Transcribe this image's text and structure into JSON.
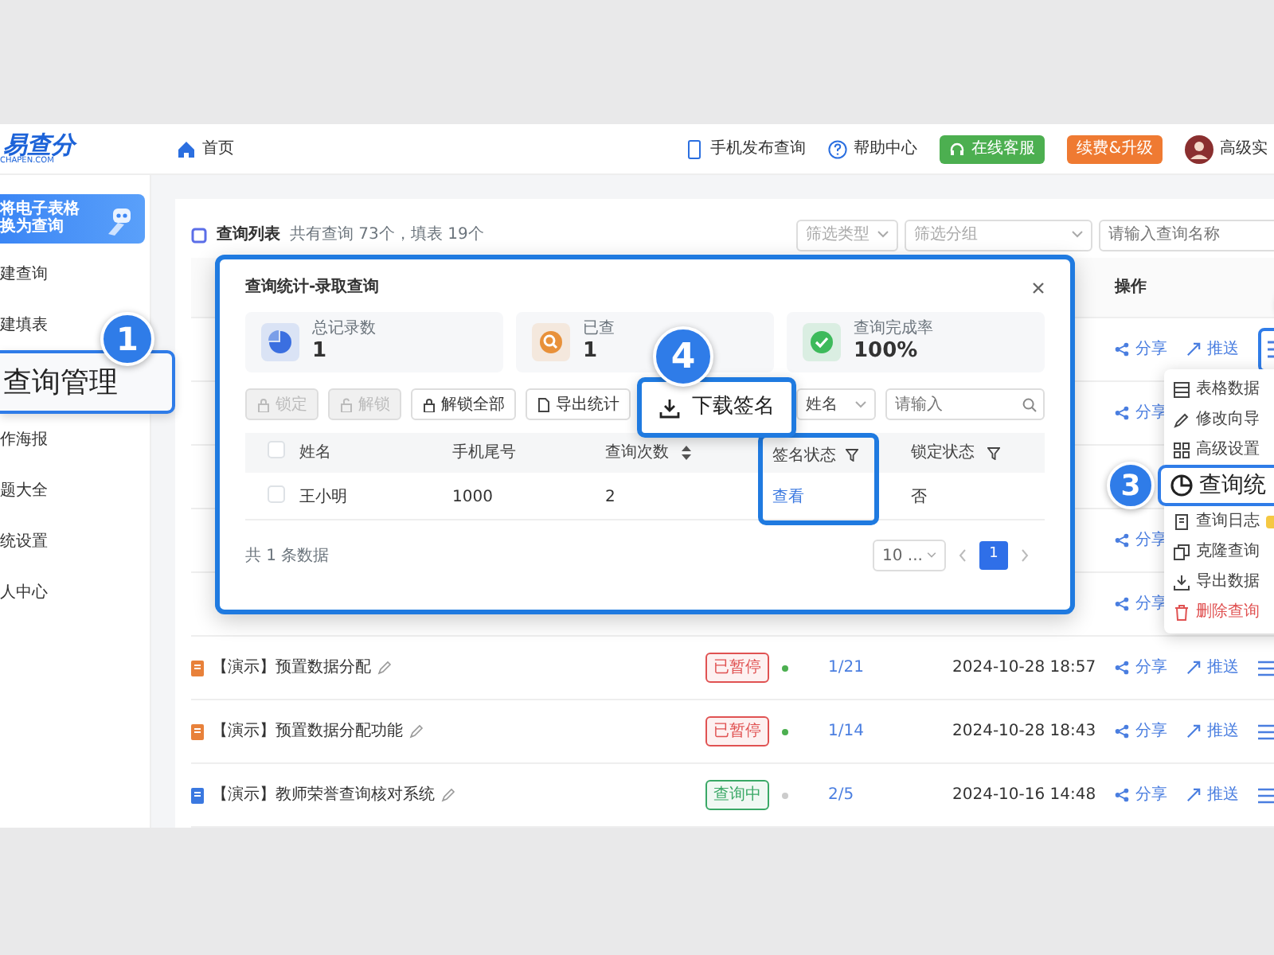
{
  "header": {
    "logo": "易查分",
    "logo_sub": "CHAPEN.COM",
    "home": "首页",
    "links": [
      "手机发布查询",
      "帮助中心"
    ],
    "service_button": "在线客服",
    "upgrade_button": "续费&升级",
    "user": "高级实"
  },
  "sidebar": {
    "banner": [
      "将电子表格",
      "换为查询"
    ],
    "items": [
      {
        "label": "建查询",
        "highlighted": false
      },
      {
        "label": "建填表",
        "highlighted": false
      },
      {
        "label": "查询管理",
        "highlighted": true,
        "step": "1"
      },
      {
        "label": "作海报",
        "highlighted": false
      },
      {
        "label": "题大全",
        "highlighted": false
      },
      {
        "label": "统设置",
        "highlighted": false
      },
      {
        "label": "人中心",
        "highlighted": false
      }
    ]
  },
  "list": {
    "title": "查询列表",
    "summary": "共有查询 73个，填表 19个",
    "filters": [
      {
        "placeholder": "筛选类型"
      },
      {
        "placeholder": "筛选分组"
      }
    ],
    "search": {
      "placeholder": "请输入查询名称"
    },
    "action_column": "操作",
    "rows": [
      {
        "share": "分享",
        "push": "推送",
        "menu": {
          "highlighted": true
        }
      },
      {
        "share": "分享"
      },
      {},
      {
        "share": "分享"
      },
      {
        "share": "分享"
      },
      {
        "color": "#e8813a",
        "name": "【演示】预置数据分配",
        "status": {
          "text": "已暂停",
          "color": "#e05252"
        },
        "dot": {
          "color": "#4caf50"
        },
        "count": "1/21",
        "date": "2024-10-28 18:57",
        "share": "分享",
        "push": "推送",
        "menu": {
          "highlighted": false
        }
      },
      {
        "color": "#e8813a",
        "name": "【演示】预置数据分配功能",
        "status": {
          "text": "已暂停",
          "color": "#e05252"
        },
        "dot": {
          "color": "#4caf50"
        },
        "count": "1/14",
        "date": "2024-10-28 18:43",
        "share": "分享",
        "push": "推送",
        "menu": {
          "highlighted": false
        }
      },
      {
        "color": "#3a78e0",
        "name": "【演示】教师荣誉查询核对系统",
        "status": {
          "text": "查询中",
          "color": "#3aa866"
        },
        "dot": {
          "color": "#cccccc"
        },
        "count": "2/5",
        "date": "2024-10-16 14:48",
        "share": "分享",
        "push": "推送",
        "menu": {
          "highlighted": false
        }
      }
    ]
  },
  "modal": {
    "title": "查询统计-录取查询",
    "stats": [
      {
        "kind": "total",
        "label": "总记录数",
        "value": "1",
        "color": "#3b6fe0"
      },
      {
        "kind": "queried",
        "label": "已查",
        "value": "1",
        "color": "#e8913a"
      },
      {
        "kind": "rate",
        "label": "查询完成率",
        "value": "100%",
        "color": "#3dba5b"
      }
    ],
    "toolbar": [
      {
        "label": "锁定",
        "disabled": true
      },
      {
        "label": "解锁",
        "disabled": true
      },
      {
        "label": "解锁全部",
        "disabled": false
      },
      {
        "label": "导出统计",
        "disabled": false
      }
    ],
    "download": {
      "label": "下载签名",
      "step": "4"
    },
    "all_selected": false,
    "field_select": "姓名",
    "search_placeholder": "请输入",
    "columns": [
      {
        "label": "姓名",
        "kind": "text",
        "sortable": false,
        "filter": false,
        "highlighted": false
      },
      {
        "label": "手机尾号",
        "kind": "text",
        "sortable": false,
        "filter": false,
        "highlighted": false
      },
      {
        "label": "查询次数",
        "kind": "text",
        "sortable": true,
        "filter": false,
        "highlighted": false
      },
      {
        "label": "签名状态",
        "kind": "link",
        "sortable": false,
        "filter": true,
        "highlighted": true
      },
      {
        "label": "锁定状态",
        "kind": "text",
        "sortable": false,
        "filter": true,
        "highlighted": false
      }
    ],
    "rows": [
      {
        "selected": false,
        "cells": [
          "王小明",
          "1000",
          "2",
          "查看",
          "否"
        ]
      }
    ],
    "total": "共 1 条数据",
    "page_size": "10 ...",
    "pages": [
      {
        "label": "1",
        "selected": true
      }
    ]
  },
  "menu": {
    "items": [
      {
        "label": "表格数据",
        "kind": "normal"
      },
      {
        "label": "修改向导",
        "kind": "normal"
      },
      {
        "label": "高级设置",
        "kind": "normal"
      },
      {
        "label": "查询统",
        "kind": "highlighted",
        "step": "3"
      },
      {
        "label": "查询日志",
        "kind": "normal",
        "badge": true
      },
      {
        "label": "克隆查询",
        "kind": "normal"
      },
      {
        "label": "导出数据",
        "kind": "normal"
      },
      {
        "label": "删除查询",
        "kind": "danger"
      }
    ]
  }
}
